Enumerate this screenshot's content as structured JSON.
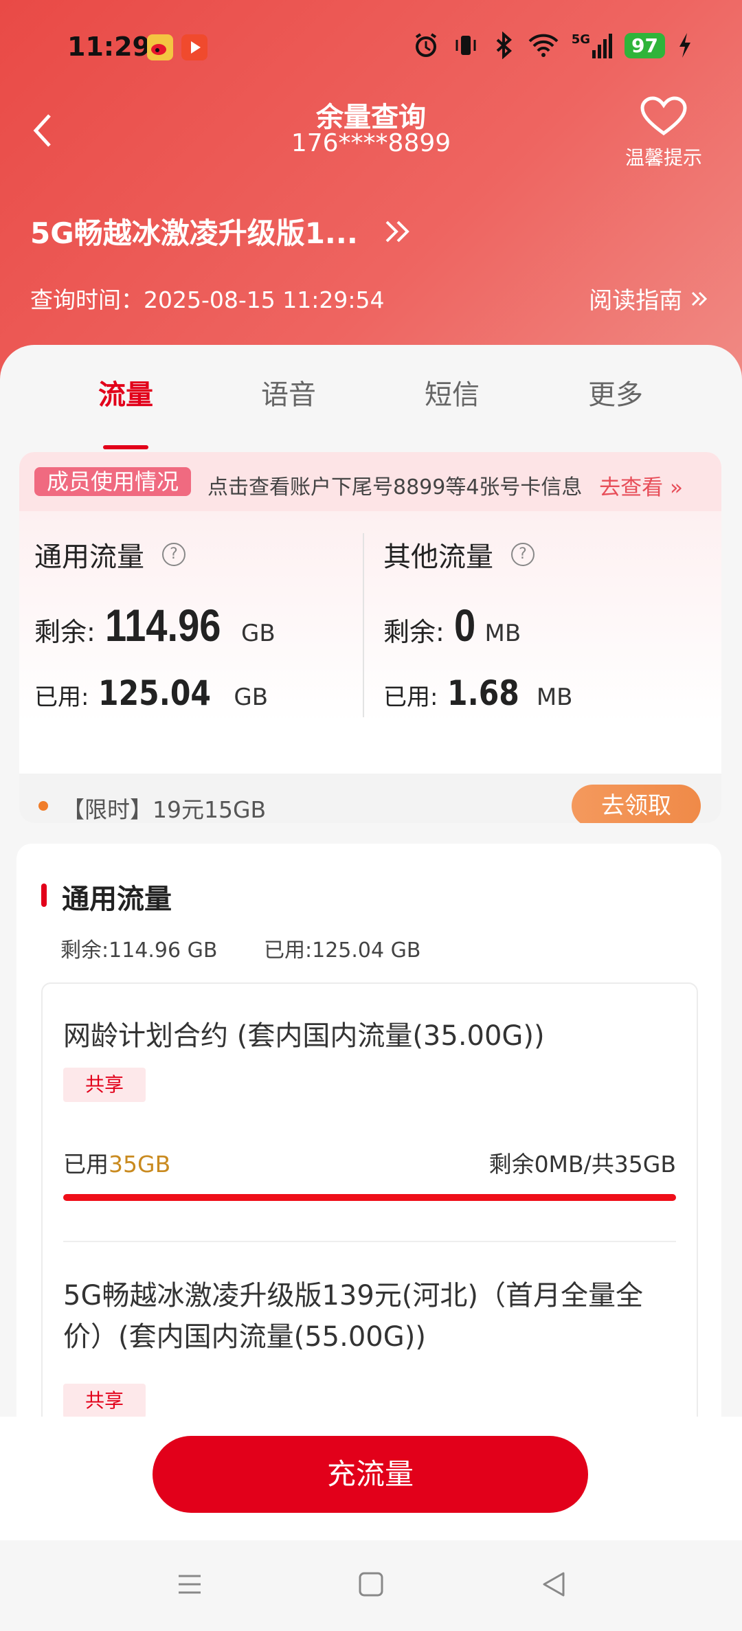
{
  "status_bar": {
    "time": "11:29",
    "battery": "97",
    "network": "5G"
  },
  "header": {
    "title": "余量查询",
    "phone": "176****8899",
    "tips_label": "温馨提示",
    "plan_name": "5G畅越冰激凌升级版1...",
    "query_time": "查询时间：2025-08-15 11:29:54",
    "guide": "阅读指南"
  },
  "tabs": [
    {
      "label": "流量",
      "active": true
    },
    {
      "label": "语音",
      "active": false
    },
    {
      "label": "短信",
      "active": false
    },
    {
      "label": "更多",
      "active": false
    }
  ],
  "member": {
    "badge": "成员使用情况",
    "text": "点击查看账户下尾号8899等4张号卡信息",
    "action": "去查看"
  },
  "general": {
    "title": "通用流量",
    "remain_label": "剩余:",
    "remain_value": "114.96",
    "remain_unit": "GB",
    "used_label": "已用:",
    "used_value": "125.04",
    "used_unit": "GB"
  },
  "other": {
    "title": "其他流量",
    "remain_label": "剩余:",
    "remain_value": "0",
    "remain_unit": "MB",
    "used_label": "已用:",
    "used_value": "1.68",
    "used_unit": "MB"
  },
  "promo": {
    "text": "【限时】19元15GB",
    "button": "去领取"
  },
  "detail": {
    "title": "通用流量",
    "remain": "剩余:114.96 GB",
    "used": "已用:125.04 GB",
    "packages": [
      {
        "name": "网龄计划合约 (套内国内流量(35.00G))",
        "tag": "共享",
        "used_prefix": "已用",
        "used_value": "35GB",
        "remain": "剩余0MB/共35GB",
        "used_fraction": 1.0
      },
      {
        "name": "5G畅越冰激凌升级版139元(河北)（首月全量全价）(套内国内流量(55.00G))",
        "tag": "共享"
      }
    ]
  },
  "recharge_button": "充流量",
  "colors": {
    "brand_red": "#e2001a",
    "header_red": "#e94a46",
    "promo_orange": "#f08a48",
    "gold": "#c98a1f"
  },
  "icons": [
    "weibo-icon",
    "video-icon",
    "alarm-icon",
    "vibrate-icon",
    "bluetooth-icon",
    "wifi-icon",
    "signal-icon",
    "charging-icon",
    "back-icon",
    "heart-icon",
    "help-icon",
    "double-chevron-icon",
    "menu-icon",
    "home-icon",
    "back-triangle-icon"
  ]
}
